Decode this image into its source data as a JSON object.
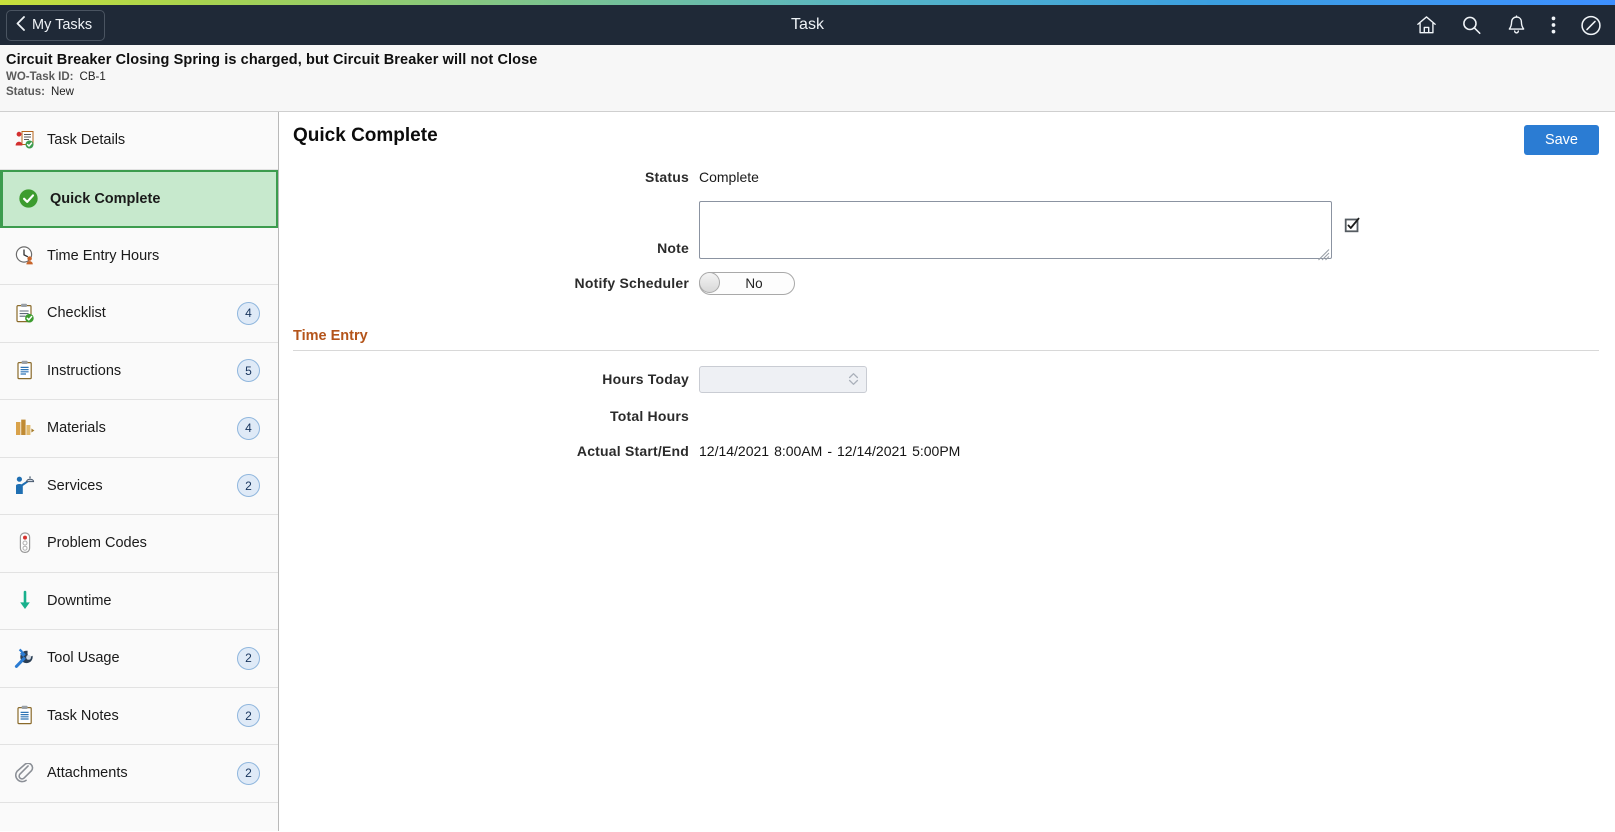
{
  "header": {
    "back_label": "My Tasks",
    "title": "Task",
    "icons": [
      {
        "name": "home-icon",
        "label": "Home"
      },
      {
        "name": "search-icon",
        "label": "Search"
      },
      {
        "name": "notifications-bell-icon",
        "label": "Notifications"
      },
      {
        "name": "actions-menu-icon",
        "label": "Actions"
      },
      {
        "name": "nav-bar-compass-icon",
        "label": "NavBar"
      }
    ]
  },
  "subheader": {
    "task_title": "Circuit Breaker Closing Spring is charged, but Circuit Breaker will not Close",
    "wo_task_id_label": "WO-Task ID:",
    "wo_task_id_value": "CB-1",
    "status_label": "Status:",
    "status_value": "New"
  },
  "sidebar": {
    "items": [
      {
        "label": "Task Details",
        "icon": "task-details-icon",
        "badge": null,
        "selected": false
      },
      {
        "label": "Quick Complete",
        "icon": "green-check-icon",
        "badge": null,
        "selected": true
      },
      {
        "label": "Time Entry Hours",
        "icon": "clock-person-icon",
        "badge": null,
        "selected": false
      },
      {
        "label": "Checklist",
        "icon": "checklist-icon",
        "badge": "4",
        "selected": false
      },
      {
        "label": "Instructions",
        "icon": "instructions-icon",
        "badge": "5",
        "selected": false
      },
      {
        "label": "Materials",
        "icon": "materials-icon",
        "badge": "4",
        "selected": false
      },
      {
        "label": "Services",
        "icon": "services-icon",
        "badge": "2",
        "selected": false
      },
      {
        "label": "Problem Codes",
        "icon": "problem-codes-icon",
        "badge": null,
        "selected": false
      },
      {
        "label": "Downtime",
        "icon": "downtime-arrow-icon",
        "badge": null,
        "selected": false
      },
      {
        "label": "Tool Usage",
        "icon": "tool-usage-icon",
        "badge": "2",
        "selected": false
      },
      {
        "label": "Task Notes",
        "icon": "task-notes-icon",
        "badge": "2",
        "selected": false
      },
      {
        "label": "Attachments",
        "icon": "paperclip-icon",
        "badge": "2",
        "selected": false
      }
    ]
  },
  "main": {
    "page_title": "Quick Complete",
    "save_label": "Save",
    "status_label": "Status",
    "status_value": "Complete",
    "note_label": "Note",
    "note_value": "",
    "note_placeholder": "",
    "notify_label": "Notify Scheduler",
    "notify_value": "No",
    "time_entry_section": "Time Entry",
    "hours_today_label": "Hours Today",
    "hours_today_value": "",
    "total_hours_label": "Total Hours",
    "total_hours_value": "",
    "actual_label": "Actual Start/End",
    "actual_start_date": "12/14/2021",
    "actual_start_time": "8:00AM",
    "actual_separator": "-",
    "actual_end_date": "12/14/2021",
    "actual_end_time": "5:00PM"
  },
  "colors": {
    "header_bg": "#1f2937",
    "accent_blue": "#2b7cd3",
    "selected_green_bg": "#c7e9cd",
    "selected_green_border": "#3c9c4e",
    "section_orange": "#b4541a",
    "badge_blue": "#dfeaf7"
  }
}
